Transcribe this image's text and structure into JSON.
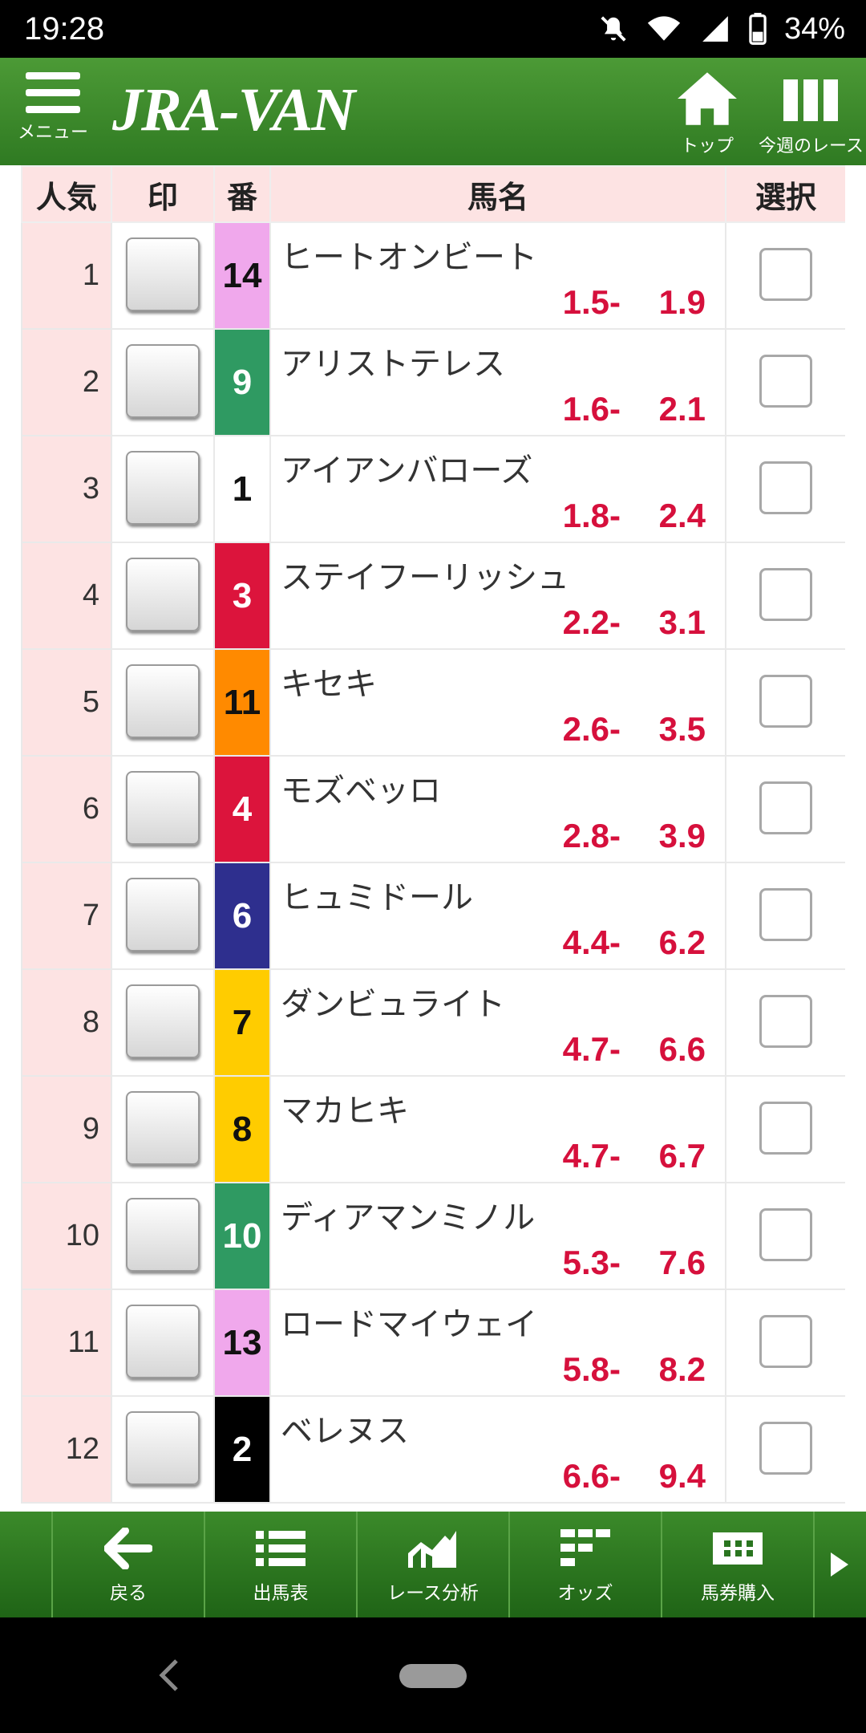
{
  "status_bar": {
    "time": "19:28",
    "battery": "34%"
  },
  "header": {
    "menu_label": "メニュー",
    "logo": "JRA-VAN",
    "top_label": "トップ",
    "week_label": "今週のレース"
  },
  "table": {
    "headers": {
      "popularity": "人気",
      "mark": "印",
      "number": "番",
      "horse_name": "馬名",
      "select": "選択"
    },
    "rows": [
      {
        "rank": "1",
        "num": "14",
        "num_bg": "#f0a8ec",
        "num_fg": "#111111",
        "name": "ヒートオンビート",
        "odds_low": "1.5",
        "odds_high": "1.9"
      },
      {
        "rank": "2",
        "num": "9",
        "num_bg": "#2f9a62",
        "num_fg": "#ffffff",
        "name": "アリストテレス",
        "odds_low": "1.6",
        "odds_high": "2.1"
      },
      {
        "rank": "3",
        "num": "1",
        "num_bg": "#ffffff",
        "num_fg": "#111111",
        "name": "アイアンバローズ",
        "odds_low": "1.8",
        "odds_high": "2.4"
      },
      {
        "rank": "4",
        "num": "3",
        "num_bg": "#dc143c",
        "num_fg": "#ffffff",
        "name": "ステイフーリッシュ",
        "odds_low": "2.2",
        "odds_high": "3.1"
      },
      {
        "rank": "5",
        "num": "11",
        "num_bg": "#ff8a00",
        "num_fg": "#111111",
        "name": "キセキ",
        "odds_low": "2.6",
        "odds_high": "3.5"
      },
      {
        "rank": "6",
        "num": "4",
        "num_bg": "#dc143c",
        "num_fg": "#ffffff",
        "name": "モズベッロ",
        "odds_low": "2.8",
        "odds_high": "3.9"
      },
      {
        "rank": "7",
        "num": "6",
        "num_bg": "#2e2f8e",
        "num_fg": "#ffffff",
        "name": "ヒュミドール",
        "odds_low": "4.4",
        "odds_high": "6.2"
      },
      {
        "rank": "8",
        "num": "7",
        "num_bg": "#ffcc00",
        "num_fg": "#111111",
        "name": "ダンビュライト",
        "odds_low": "4.7",
        "odds_high": "6.6"
      },
      {
        "rank": "9",
        "num": "8",
        "num_bg": "#ffcc00",
        "num_fg": "#111111",
        "name": "マカヒキ",
        "odds_low": "4.7",
        "odds_high": "6.7"
      },
      {
        "rank": "10",
        "num": "10",
        "num_bg": "#2f9a62",
        "num_fg": "#ffffff",
        "name": "ディアマンミノル",
        "odds_low": "5.3",
        "odds_high": "7.6"
      },
      {
        "rank": "11",
        "num": "13",
        "num_bg": "#f0a8ec",
        "num_fg": "#111111",
        "name": "ロードマイウェイ",
        "odds_low": "5.8",
        "odds_high": "8.2"
      },
      {
        "rank": "12",
        "num": "2",
        "num_bg": "#000000",
        "num_fg": "#ffffff",
        "name": "ベレヌス",
        "odds_low": "6.6",
        "odds_high": "9.4"
      }
    ]
  },
  "toolbar": {
    "back": "戻る",
    "entries": "出馬表",
    "analysis": "レース分析",
    "odds": "オッズ",
    "purchase": "馬券購入"
  },
  "colors": {
    "header_green": "#3e8a2b",
    "odds_red": "#d6103c",
    "rank_bg": "#fde3e3"
  }
}
